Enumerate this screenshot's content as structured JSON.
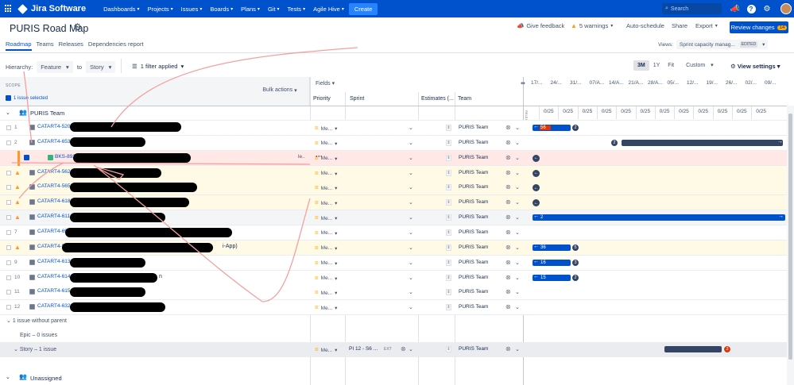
{
  "nav": {
    "logo_text": "Jira Software",
    "menus": [
      "Dashboards",
      "Projects",
      "Issues",
      "Boards",
      "Plans",
      "Git",
      "Tests",
      "Agile Hive"
    ],
    "create_label": "Create",
    "search_placeholder": "Search"
  },
  "page": {
    "title": "PURIS Road Map",
    "give_feedback": "Give feedback",
    "warnings": "5 warnings",
    "auto_schedule": "Auto-schedule",
    "share": "Share",
    "export": "Export",
    "review_changes": "Review changes",
    "review_count": "14"
  },
  "tabs": [
    "Roadmap",
    "Teams",
    "Releases",
    "Dependencies report"
  ],
  "views": {
    "label": "Views:",
    "selected": "Sprint capacity manag...",
    "edited": "EDITED"
  },
  "filters": {
    "hierarchy_label": "Hierarchy:",
    "hierarchy_from": "Feature",
    "to_label": "to",
    "hierarchy_to": "Story",
    "filter_applied": "1 filter applied"
  },
  "zoom": {
    "options": [
      "3M",
      "1Y",
      "Fit",
      "Custom"
    ],
    "selected": "3M",
    "view_settings": "View settings"
  },
  "columns": {
    "scope": "SCOPE",
    "issue_selected": "1 issue selected",
    "bulk_actions": "Bulk actions",
    "fields": "Fields",
    "priority": "Priority",
    "sprint": "Sprint",
    "estimates": "Estimates (...",
    "team": "Team"
  },
  "timeline": {
    "dates": [
      "17/...",
      "24/...",
      "31/...",
      "07/A...",
      "14/A...",
      "21/A...",
      "28/A...",
      "05/...",
      "12/...",
      "19/...",
      "26/...",
      "02/...",
      "09/..."
    ],
    "capacity": [
      "0/25",
      "0/25",
      "0/25",
      "0/25",
      "0/25",
      "0/25",
      "0/25",
      "0/25",
      "0/25",
      "0/25",
      "0/25",
      "0/25"
    ],
    "release_label": "RELEASE"
  },
  "team_group": "PURIS Team",
  "priority_value": "Me...",
  "rows": [
    {
      "num": "1",
      "key": "CATART4-520",
      "team": "PURIS Team",
      "warn": false
    },
    {
      "num": "2",
      "key": "CATART4-653",
      "team": "PURIS Team",
      "warn": false
    },
    {
      "num": "",
      "key": "BKS-892",
      "team": "PURIS Team",
      "warn": false,
      "selected": true
    },
    {
      "num": "",
      "key": "CATART4-562",
      "team": "PURIS Team",
      "warn": true
    },
    {
      "num": "",
      "key": "CATART4-565",
      "team": "PURIS Team",
      "warn": true
    },
    {
      "num": "",
      "key": "CATART4-618",
      "team": "PURIS Team",
      "warn": true
    },
    {
      "num": "",
      "key": "CATART4-611",
      "team": "PURIS Team",
      "warn": true
    },
    {
      "num": "7",
      "key": "CATART4-69",
      "team": "PURIS Team",
      "warn": false
    },
    {
      "num": "",
      "key": "CATART4-5",
      "team": "PURIS Team",
      "warn": true,
      "suffix": "i-App)"
    },
    {
      "num": "9",
      "key": "CATART4-613",
      "team": "PURIS Team",
      "warn": false
    },
    {
      "num": "10",
      "key": "CATART4-614",
      "team": "PURIS Team",
      "warn": false,
      "suffix": "n"
    },
    {
      "num": "11",
      "key": "CATART4-615",
      "team": "PURIS Team",
      "warn": false
    },
    {
      "num": "12",
      "key": "CATART4-632",
      "team": "PURIS Team",
      "warn": false
    }
  ],
  "bars": {
    "r1": "56",
    "r1b": "2",
    "r2": "2",
    "r7": "2",
    "r9": "36",
    "r9b": "5",
    "r10": "16",
    "r10b": "3",
    "r11": "15",
    "r11b": "2",
    "story": "2"
  },
  "sections": {
    "without_parent": "1 issue without parent",
    "epic": "Epic – 0 issues",
    "story": "Story – 1 issue",
    "story_sprint": "PI 12 - S6 ...",
    "story_sprint_tag": "EXT",
    "unassigned": "Unassigned"
  }
}
